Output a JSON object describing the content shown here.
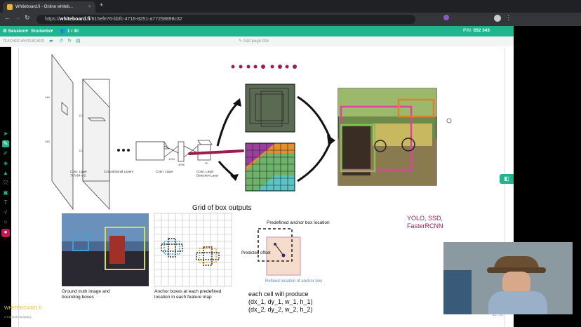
{
  "browser": {
    "tab_title": "Whiteboard.fi - Online whiteb...",
    "url_plain": "https://",
    "url_bold": "whiteboard.fi",
    "url_rest": "/815efe76-bbfc-4716-8251-a77258898c32"
  },
  "app": {
    "session_label": "Session",
    "students_label": "Students",
    "student_count": "1 / 40",
    "pin_label": "PIN:",
    "pin_value": "652 343"
  },
  "toolbar": {
    "teacher_label": "TEACHER WHITEBOARD",
    "add_page_title": "Add page title"
  },
  "diagram": {
    "conv_labels": [
      "Conv. Layer\n7x7x64-s-2",
      "Convolutional Layers",
      "Conn. Layer",
      "Conn. Layer\nDetection Layer"
    ],
    "dims": [
      "448",
      "448",
      "3",
      "112",
      "112",
      "192",
      "3",
      "3",
      "1024",
      "7",
      "4096",
      "30"
    ],
    "grid_title": "Grid of box outputs",
    "caption_gt": "Ground truth image and\nbounding boxes",
    "caption_anchor": "Anchor boxes at each predefined\nlocation in each feature map",
    "predef_label": "Predefined anchor box location",
    "offset_label": "Predicted offset",
    "refined_label": "Refined location of anchor box",
    "each_cell": "each cell will produce",
    "tuple1": "(dx_1, dy_1, w_1, h_1)",
    "tuple2": "(dx_2, dy_2, w_2, h_2)",
    "models": "YOLO, SSD,\nFasterRCNN"
  },
  "footer": {
    "brand": "WHITEBOARD.fi",
    "page": "11 / 12",
    "company": "a Kahoot! company"
  },
  "colors": {
    "accent": "#1fb68e",
    "magenta": "#c2185b",
    "annot": "#9e1c4c"
  }
}
